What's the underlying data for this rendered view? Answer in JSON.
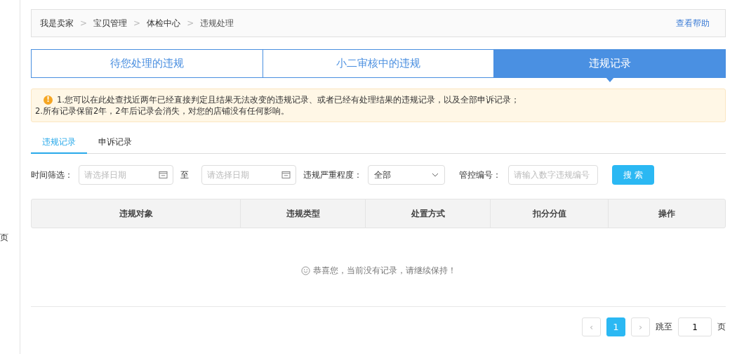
{
  "sidebar": {
    "items": [
      {
        "label": "页"
      }
    ]
  },
  "breadcrumb": {
    "items": [
      "我是卖家",
      "宝贝管理",
      "体检中心",
      "违规处理"
    ],
    "separator": ">",
    "help": "查看帮助"
  },
  "tabs": [
    {
      "label": "待您处理的违规",
      "selected": false
    },
    {
      "label": "小二审核中的违规",
      "selected": false
    },
    {
      "label": "违规记录",
      "selected": true
    }
  ],
  "notice": {
    "icon": "!",
    "lines": [
      "1.您可以在此处查找近两年已经直接判定且结果无法改变的违规记录、或者已经有处理结果的违规记录，以及全部申诉记录；",
      "2.所有记录保留2年，2年后记录会消失，对您的店铺没有任何影响。"
    ]
  },
  "subtabs": [
    {
      "label": "违规记录",
      "selected": true
    },
    {
      "label": "申诉记录",
      "selected": false
    }
  ],
  "filters": {
    "time_label": "时间筛选：",
    "start_placeholder": "请选择日期",
    "to": "至",
    "end_placeholder": "请选择日期",
    "severity_label": "违规严重程度：",
    "severity_value": "全部",
    "code_label": "管控编号：",
    "code_placeholder": "请输入数字违规编号",
    "search_button": "搜 索"
  },
  "table": {
    "columns": [
      "违规对象",
      "违规类型",
      "处置方式",
      "扣分分值",
      "操作"
    ],
    "empty_message": "恭喜您，当前没有记录，请继续保持！"
  },
  "pagination": {
    "prev": "‹",
    "pages": [
      {
        "label": "1",
        "selected": true
      }
    ],
    "next": "›",
    "jump_label": "跳至",
    "jump_value": "1",
    "page_suffix": "页"
  }
}
